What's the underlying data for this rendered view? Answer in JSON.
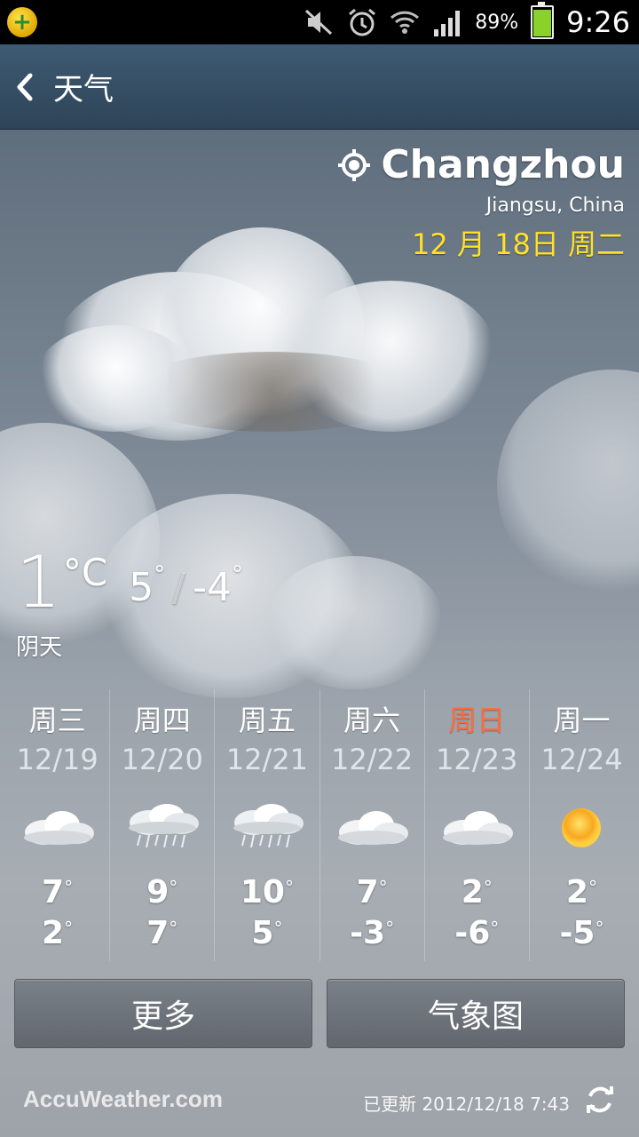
{
  "status_bar": {
    "battery_percent": "89%",
    "time": "9:26",
    "battery_level": 0.89
  },
  "header": {
    "title": "天气"
  },
  "location": {
    "city": "Changzhou",
    "region": "Jiangsu, China",
    "date": "12 月 18日 周二"
  },
  "current": {
    "temp": "1",
    "unit": "°C",
    "high": "5",
    "low": "-4",
    "condition": "阴天"
  },
  "forecast": [
    {
      "day": "周三",
      "date": "12/19",
      "icon": "cloudy-icon",
      "high": "7",
      "low": "2",
      "highlight": false
    },
    {
      "day": "周四",
      "date": "12/20",
      "icon": "rain-icon",
      "high": "9",
      "low": "7",
      "highlight": false
    },
    {
      "day": "周五",
      "date": "12/21",
      "icon": "rain-icon",
      "high": "10",
      "low": "5",
      "highlight": false
    },
    {
      "day": "周六",
      "date": "12/22",
      "icon": "cloudy-icon",
      "high": "7",
      "low": "-3",
      "highlight": false
    },
    {
      "day": "周日",
      "date": "12/23",
      "icon": "cloudy-icon",
      "high": "2",
      "low": "-6",
      "highlight": true
    },
    {
      "day": "周一",
      "date": "12/24",
      "icon": "sun-icon",
      "high": "2",
      "low": "-5",
      "highlight": false
    }
  ],
  "buttons": {
    "more": "更多",
    "chart": "气象图"
  },
  "footer": {
    "brand": "AccuWeather.com",
    "updated": "已更新 2012/12/18 7:43"
  },
  "colors": {
    "accent_date": "#ffe12a",
    "sunday": "#ff6b3a",
    "titlebar": "#3e5a72"
  }
}
